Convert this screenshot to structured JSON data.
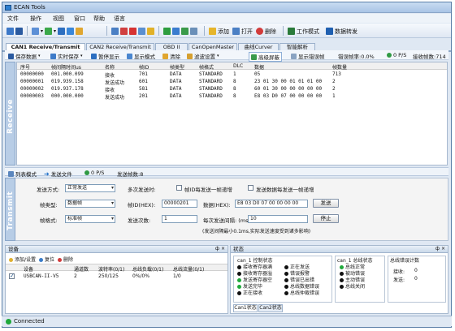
{
  "window": {
    "title": "ECAN Tools"
  },
  "menu": [
    "文件",
    "操作",
    "视图",
    "窗口",
    "帮助",
    "语言"
  ],
  "toolbar": {
    "add": "添加",
    "open": "打开",
    "delete": "删除",
    "work_mode": "工作模式",
    "forward": "数据转发"
  },
  "tabs": [
    {
      "label": "CAN1 Receive/Transmit",
      "active": true
    },
    {
      "label": "CAN2 Receive/Transmit",
      "active": false
    },
    {
      "label": "OBD II",
      "active": false
    },
    {
      "label": "CanOpenMaster",
      "active": false
    },
    {
      "label": "曲线Curver",
      "active": false
    },
    {
      "label": "智能解析",
      "active": false
    }
  ],
  "subtoolbar": {
    "save": "保存数据",
    "realtime": "实时保存",
    "pause": "暂停显示",
    "display": "显示模式",
    "clear": "清除",
    "filter": "滤波设置",
    "advanced": "高级屏蔽",
    "show_err": "显示错误帧",
    "rate_label": "错误帧率:0.0%",
    "fps_value": "0",
    "fps_unit": "P/S",
    "rx_count": "接收帧数:714"
  },
  "side_labels": {
    "receive": "Receive",
    "transmit": "Transmit"
  },
  "table": {
    "headers": [
      "序号",
      "帧间隔时间us",
      "名称",
      "帧ID",
      "帧类型",
      "帧格式",
      "DLC",
      "数据",
      "帧数量"
    ],
    "rows": [
      [
        "00000000",
        "001.000.099",
        "接收",
        "701",
        "DATA",
        "STANDARD",
        "1",
        "05",
        "713"
      ],
      [
        "00000001",
        "019.939.158",
        "发送成功",
        "601",
        "DATA",
        "STANDARD",
        "8",
        "23 01 30 00 01 01 01 00",
        "2"
      ],
      [
        "00000002",
        "019.937.178",
        "接收",
        "581",
        "DATA",
        "STANDARD",
        "8",
        "60 01 30 00 00 00 00 00",
        "2"
      ],
      [
        "00000003",
        "000.000.000",
        "发送成功",
        "201",
        "DATA",
        "STANDARD",
        "8",
        "E8 03 D0 07 00 00 00 00",
        "1"
      ]
    ]
  },
  "statusrow": {
    "list_mode": "列表模式",
    "send_file": "发送文件",
    "rate": "0 P/S",
    "sent": "发送帧数:8"
  },
  "send": {
    "method_label": "发送方式:",
    "method_value": "正常发送",
    "multi_label": "多次发送时:",
    "id_inc": "帧ID每发送一帧递增",
    "data_inc": "发送数据每发送一帧递增",
    "type_label": "帧类型:",
    "type_value": "数据帧",
    "id_label": "帧ID(HEX):",
    "id_value": "00000201",
    "data_label": "数据(HEX):",
    "data_value": "E8 03 D0 07 00 00 00 00",
    "send_btn": "发送",
    "format_label": "帧格式:",
    "format_value": "标准帧",
    "count_label": "发送次数:",
    "count_value": "1",
    "interval_label": "每次发送间隔: (ms)",
    "interval_value": "10",
    "stop_btn": "停止",
    "note": "(发送间隔最小0.1ms,实际发送速度受到诸多影响)"
  },
  "device": {
    "title": "设备",
    "actions": {
      "add": "添加/设置",
      "reset": "复位",
      "delete": "删除"
    },
    "headers": [
      "设备",
      "通道数",
      "波特率(0/1)",
      "总线负载(0/1)",
      "总线流量(0/1)"
    ],
    "rows": [
      [
        "USBCAN-II-V5",
        "2",
        "250/125",
        "0%/0%",
        "1/0"
      ]
    ]
  },
  "status_panel": {
    "title": "状态",
    "ctrl_title": "can_1 控制状态",
    "ctrl_items_a": [
      "接收寄存器满",
      "接收寄存器溢",
      "发送寄存器空",
      "发送完毕",
      "正在接收"
    ],
    "ctrl_items_b": [
      "正在发送",
      "错误报警",
      "错误已出错",
      "总线数据错误",
      "总线仲裁错误"
    ],
    "bus_title": "can_1 总线状态",
    "bus_items": [
      "总线正常",
      "被动错误",
      "主动错误",
      "总线关闭"
    ],
    "err_title": "总线错误计数",
    "rx_label": "接收:",
    "rx_val": "0",
    "tx_label": "发送:",
    "tx_val": "0",
    "tabs": [
      "Can1状态",
      "Can2状态"
    ]
  },
  "statusbar": {
    "text": "Connected"
  }
}
